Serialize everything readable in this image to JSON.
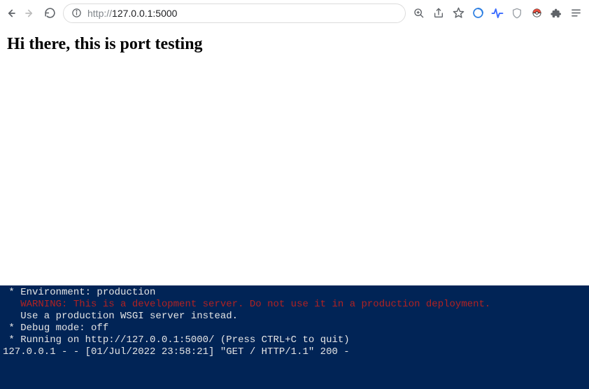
{
  "toolbar": {
    "url_protocol": "http://",
    "url_rest": "127.0.0.1:5000"
  },
  "page": {
    "heading": "Hi there, this is port testing"
  },
  "terminal": {
    "bullet": " * ",
    "line1": "Environment: production",
    "warn_prefix": "   WARNING: ",
    "warn_text": "This is a development server. Do not use it in a production deployment.",
    "line3": "   Use a production WSGI server instead.",
    "line4": "Debug mode: off",
    "line5": "Running on http://127.0.0.1:5000/ (Press CTRL+C to quit)",
    "line6": "127.0.0.1 - - [01/Jul/2022 23:58:21] \"GET / HTTP/1.1\" 200 -"
  }
}
